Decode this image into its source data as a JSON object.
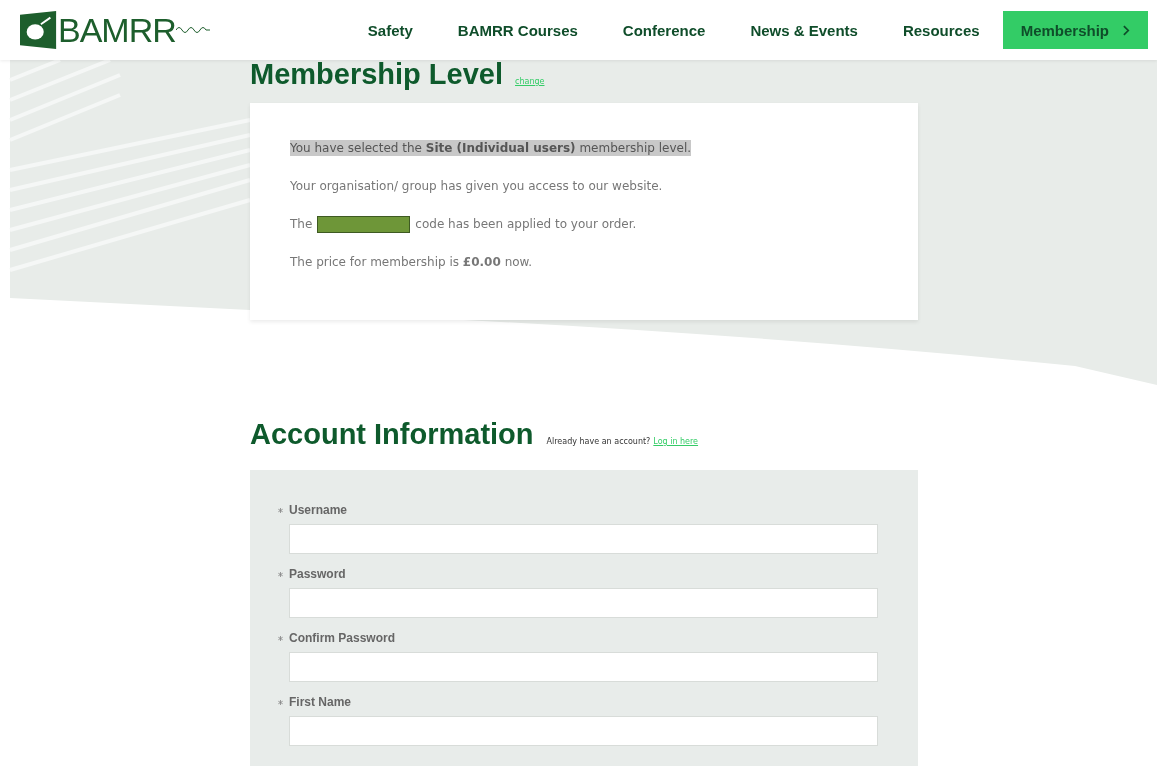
{
  "header": {
    "logo_text": "BAMRR",
    "nav": [
      {
        "label": "Safety",
        "kind": "link"
      },
      {
        "label": "BAMRR Courses",
        "kind": "link"
      },
      {
        "label": "Conference",
        "kind": "link"
      },
      {
        "label": "News & Events",
        "kind": "link"
      },
      {
        "label": "Resources",
        "kind": "link"
      },
      {
        "label": "Membership",
        "kind": "button"
      }
    ]
  },
  "membership_level": {
    "title": "Membership Level",
    "change_link": "change",
    "selection": {
      "text": "You have selected the **Site (Individual users)** membership level.",
      "highlighted": true
    },
    "access_note": "Your organisation/ group has given you access to our website.",
    "code_line": {
      "before": "The",
      "redacted": true,
      "after": "code has been applied to your order."
    },
    "price_line": "The price for membership is **£0.00** now."
  },
  "account_information": {
    "title": "Account Information",
    "prompt": "Already have an account?",
    "login_link": "Log in here",
    "fields": [
      {
        "label": "Username",
        "required": true
      },
      {
        "label": "Password",
        "required": true
      },
      {
        "label": "Confirm Password",
        "required": true
      },
      {
        "label": "First Name",
        "required": true
      }
    ]
  }
}
